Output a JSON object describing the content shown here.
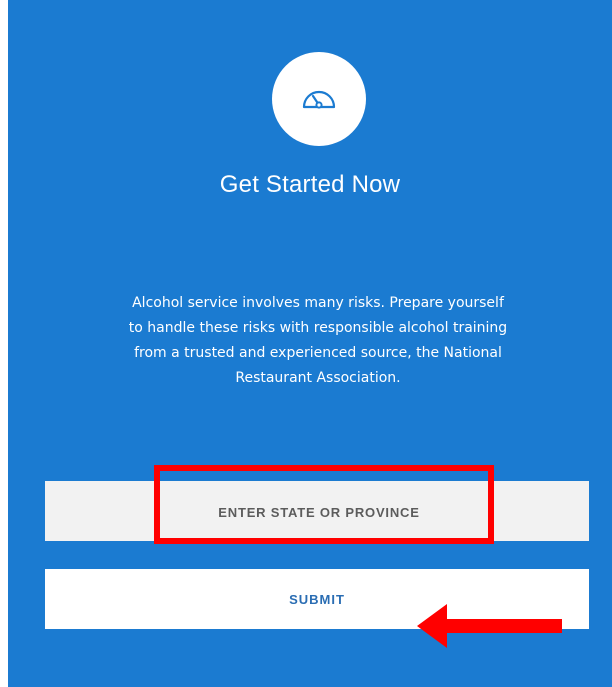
{
  "panel": {
    "background": "#1b7bd1",
    "icon": "speedometer-icon",
    "title": "Get Started Now",
    "description": "Alcohol service involves many risks. Prepare yourself to handle these risks with responsible alcohol training from a trusted and experienced source, the National Restaurant Association."
  },
  "form": {
    "state_placeholder": "ENTER STATE OR PROVINCE",
    "submit_label": "SUBMIT"
  },
  "annotations": {
    "highlight_color": "#ff0000",
    "arrow_icon": "left-arrow-icon"
  }
}
